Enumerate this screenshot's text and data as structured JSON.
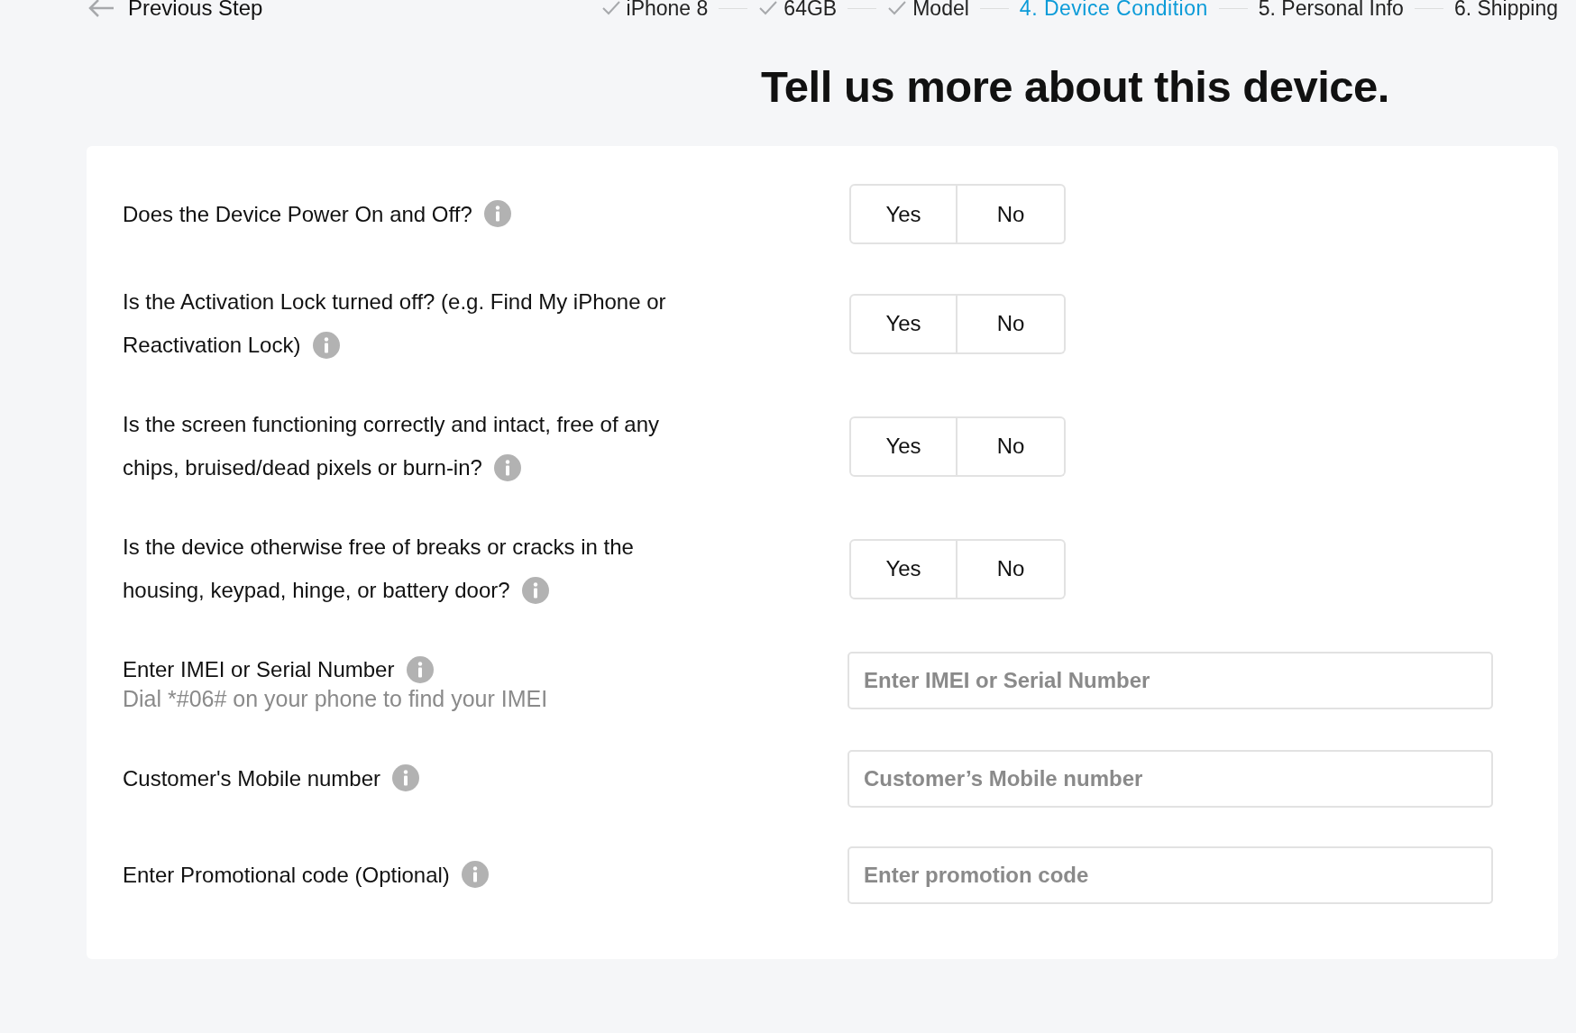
{
  "back_link": {
    "label": "Previous Step"
  },
  "steps": [
    {
      "label": "iPhone 8",
      "done": true,
      "selected": false
    },
    {
      "label": "64GB",
      "done": true,
      "selected": false
    },
    {
      "label": "Model",
      "done": true,
      "selected": false
    },
    {
      "label": "4. Device Condition",
      "done": false,
      "selected": true
    },
    {
      "label": "5. Personal Info",
      "done": false,
      "selected": false
    },
    {
      "label": "6. Shipping",
      "done": false,
      "selected": false
    }
  ],
  "heading": "Tell us more about this device.",
  "questions": [
    {
      "kind": "yes_no",
      "label": "Does the Device Power On and Off?",
      "options": [
        {
          "label": "Yes",
          "selected": false
        },
        {
          "label": "No",
          "selected": false
        }
      ]
    },
    {
      "kind": "yes_no",
      "label": "Is the Activation Lock turned off? (e.g. Find My iPhone or Reactivation Lock)",
      "options": [
        {
          "label": "Yes",
          "selected": false
        },
        {
          "label": "No",
          "selected": false
        }
      ]
    },
    {
      "kind": "yes_no",
      "label": "Is the screen functioning correctly and intact, free of any chips, bruised/dead pixels or burn-in?",
      "options": [
        {
          "label": "Yes",
          "selected": false
        },
        {
          "label": "No",
          "selected": false
        }
      ]
    },
    {
      "kind": "yes_no",
      "label": "Is the device otherwise free of breaks or cracks in the housing, keypad, hinge, or battery door?",
      "options": [
        {
          "label": "Yes",
          "selected": false
        },
        {
          "label": "No",
          "selected": false
        }
      ]
    },
    {
      "kind": "input",
      "label": "Enter IMEI or Serial Number",
      "hint": "Dial *#06# on your phone to find your IMEI",
      "placeholder": "Enter IMEI or Serial Number"
    },
    {
      "kind": "input",
      "label": "Customer's Mobile number",
      "placeholder": "Customer’s Mobile number"
    },
    {
      "kind": "input",
      "label": "Enter Promotional code (Optional)",
      "placeholder": "Enter promotion code"
    }
  ]
}
